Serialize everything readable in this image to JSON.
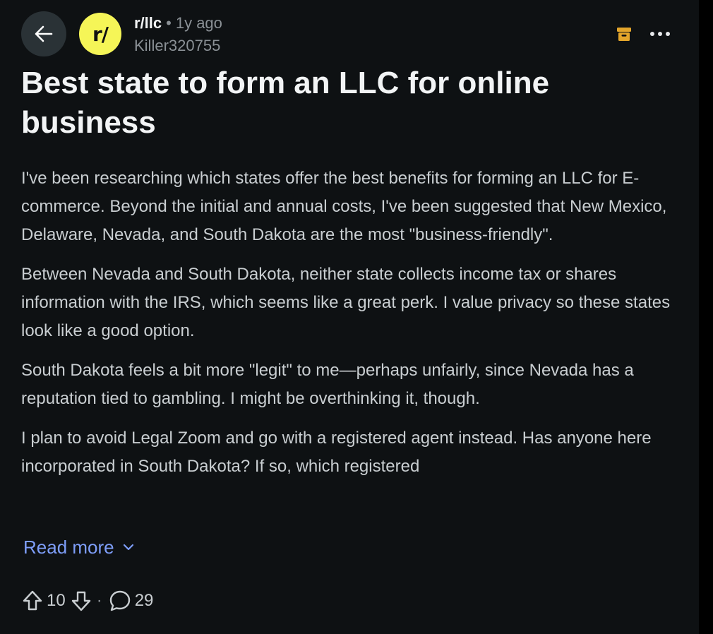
{
  "header": {
    "subreddit": "r/llc",
    "separator": "•",
    "age": "1y ago",
    "author": "Killer320755",
    "avatar_text": "r/",
    "icons": {
      "back": "arrow-left-icon",
      "archive": "archive-icon",
      "more": "more-horizontal-icon"
    },
    "colors": {
      "avatar": "#f5f557",
      "archive": "#e3a52b"
    }
  },
  "post": {
    "title": "Best state to form an LLC for online business",
    "paragraphs": [
      "I've been researching which states offer the best benefits for forming an LLC for E-commerce. Beyond the initial and annual costs, I've been suggested that New Mexico, Delaware, Nevada, and South Dakota are the most \"business-friendly\".",
      "Between Nevada and South Dakota, neither state collects income tax or shares information with the IRS, which seems like a great perk. I value privacy so these states look like a good option.",
      "South Dakota feels a bit more \"legit\" to me—perhaps unfairly, since Nevada has a reputation tied to gambling. I might be overthinking it, though.",
      "I plan to avoid Legal Zoom and go with a registered agent instead. Has anyone here incorporated in South Dakota? If so, which registered"
    ],
    "read_more": "Read more"
  },
  "actions": {
    "upvotes": "10",
    "separator": "·",
    "comments": "29",
    "colors": {
      "link": "#7e9ef9"
    }
  }
}
